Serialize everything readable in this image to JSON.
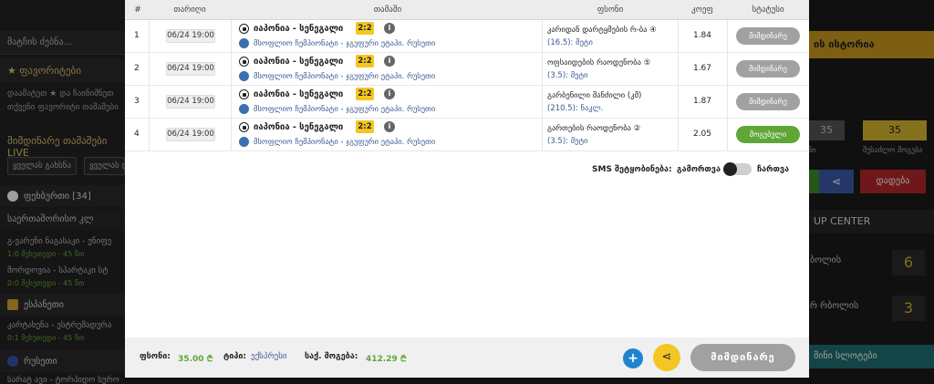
{
  "background": {
    "search_placeholder": "მატჩის ძებნა...",
    "favorites_title": "ფავორიტები",
    "favorites_text": "დაამატეთ ★ და ჩაინიშნეთ თქვენი ფავორიტი თამაშები",
    "live_title": "მიმდინარე თამაშები LIVE",
    "chip1": "ყველას გახსნა",
    "chip2": "ყველას დახურვა",
    "sport1": "ფეხბურთი [34]",
    "league1": "საერთაშორისო კლ",
    "match1": "გ-ვარენი ნაგასაკი - უნიფე",
    "match1_sub": "1:0 მეხუთედი - 45 წთ",
    "match2": "მორდოვია - სპარტაკი სტ",
    "match2_sub": "0:0 მეხუთედი - 45 წთ",
    "sport2": "ესპანეთი",
    "match3": "კარტახენა - ესტრემადურა",
    "match3_sub": "0:1 მეხუთედი - 45 წთ",
    "sport3": "რუსეთი",
    "match4": "სარატ ავი - ტორპიდო სურო",
    "history_btn": "ის ისტორია",
    "box_left": "35",
    "box_right": "35",
    "box_left_label": "ნი",
    "box_right_label": "შესაძლო მოგება",
    "share_glyph": "⋖",
    "red_btn": "დადება",
    "center_title": "UP CENTER",
    "row1_label": "ბოლის",
    "row1_num": "6",
    "row2_label": "რ რბოლის",
    "row2_num": "3",
    "slots": "მინი სლოტები"
  },
  "table": {
    "headers": [
      "#",
      "თარიღი",
      "თამაში",
      "ფსონი",
      "კოეფ",
      "სტატუსი"
    ],
    "rows": [
      {
        "num": "1",
        "date": "06/24 19:00",
        "match": "იაპონია - სენეგალი",
        "score": "2:2",
        "info": "i",
        "league": "მსოფლიო ჩემპიონატი - ჯგუფური ეტაპი. რუსეთი",
        "bet_line1": "კარიდან დარტყმების რ-ბა ④",
        "bet_line2": "(16.5): მეტი",
        "odd": "1.84",
        "status": "მიმდინარე",
        "status_type": "gray"
      },
      {
        "num": "2",
        "date": "06/24 19:00",
        "match": "იაპონია - სენეგალი",
        "score": "2:2",
        "info": "i",
        "league": "მსოფლიო ჩემპიონატი - ჯგუფური ეტაპი. რუსეთი",
        "bet_line1": "ოფსაიდების რაოდენობა ⑤",
        "bet_line2": "(3.5): მეტი",
        "odd": "1.67",
        "status": "მიმდინარე",
        "status_type": "gray"
      },
      {
        "num": "3",
        "date": "06/24 19:00",
        "match": "იაპონია - სენეგალი",
        "score": "2:2",
        "info": "i",
        "league": "მსოფლიო ჩემპიონატი - ჯგუფური ეტაპი. რუსეთი",
        "bet_line1": "გარბენილი მანძილი (კმ)",
        "bet_line2": "(210.5): ნაკლ.",
        "odd": "1.87",
        "status": "მიმდინარე",
        "status_type": "gray"
      },
      {
        "num": "4",
        "date": "06/24 19:00",
        "match": "იაპონია - სენეგალი",
        "score": "2:2",
        "info": "i",
        "league": "მსოფლიო ჩემპიონატი - ჯგუფური ეტაპი. რუსეთი",
        "bet_line1": "გართების რაოდენობა ②",
        "bet_line2": "(3.5): მეტი",
        "odd": "2.05",
        "status": "მოგებული",
        "status_type": "green"
      }
    ]
  },
  "sms": {
    "label": "SMS შეტყობინება:",
    "off": "გამორთვა",
    "on": "ჩართვა"
  },
  "footer": {
    "stake_label": "ფსონი:",
    "stake_value": "35.00 ₾",
    "type_label": "ტიპი:",
    "type_value": "ექსპრესი",
    "win_label": "საქ. მოგება:",
    "win_value": "412.29 ₾",
    "plus": "+",
    "share": "⋖",
    "status": "მიმდინარე"
  },
  "colors": {
    "accent_yellow": "#f3c623",
    "status_gray": "#a1a1a1",
    "status_green": "#5fa637",
    "plus_blue": "#1e84d0"
  }
}
